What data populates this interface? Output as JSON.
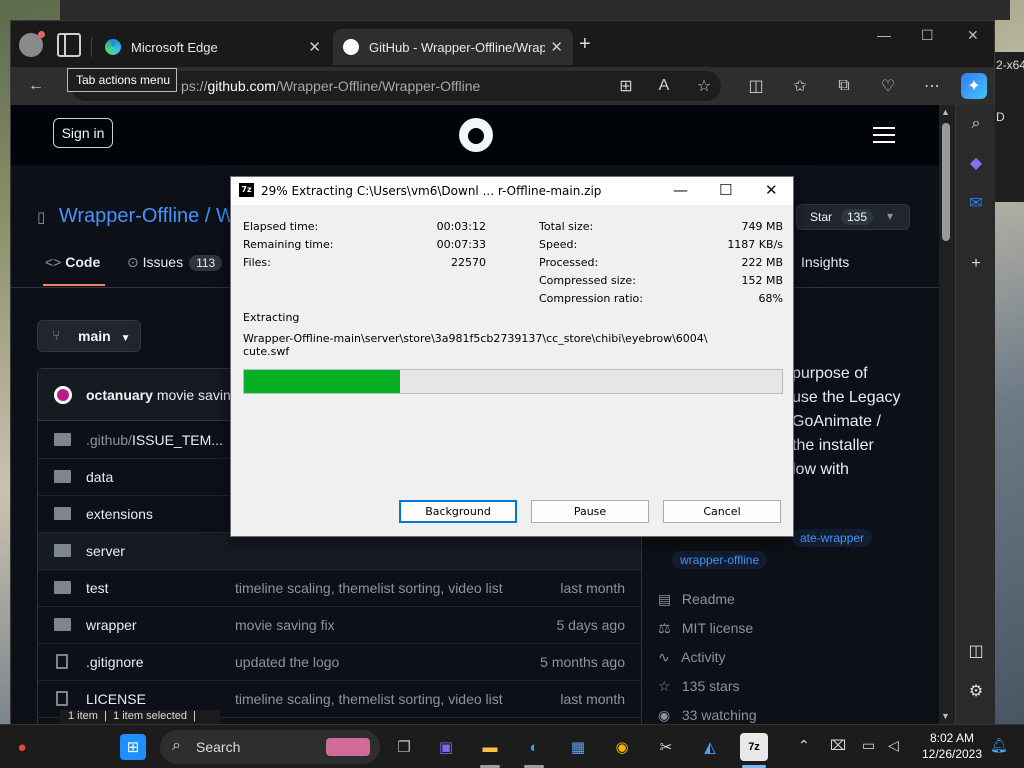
{
  "background": {
    "left_window_text": "2-x64",
    "left_window_text2": "D"
  },
  "browser": {
    "tabs": [
      {
        "label": "Microsoft Edge",
        "active": false
      },
      {
        "label": "GitHub - Wrapper-Offline/Wrapp",
        "active": true
      }
    ],
    "tooltip": "Tab actions menu",
    "url_prefix": "ps://",
    "url_host": "github.com",
    "url_path": "/Wrapper-Offline/Wrapper-Offline"
  },
  "github": {
    "sign_in": "Sign in",
    "repo_owner": "Wrapper-Offline",
    "repo_sep": "/",
    "repo_name_partial": "W",
    "star_label": "Star",
    "star_count": "135",
    "nav": {
      "code": "Code",
      "issues": "Issues",
      "issues_count": "113",
      "insights": "Insights"
    },
    "branch": "main",
    "commit": {
      "author": "octanuary",
      "message": "movie saving"
    },
    "files": [
      {
        "name_muted": ".github/",
        "name": "ISSUE_TEM...",
        "type": "folder",
        "message": "",
        "date": ""
      },
      {
        "name_muted": "",
        "name": "data",
        "type": "folder",
        "message": "",
        "date": ""
      },
      {
        "name_muted": "",
        "name": "extensions",
        "type": "folder",
        "message": "",
        "date": ""
      },
      {
        "name_muted": "",
        "name": "server",
        "type": "folder",
        "message": "",
        "date": ""
      },
      {
        "name_muted": "",
        "name": "test",
        "type": "folder",
        "message": "timeline scaling, themelist sorting, video list",
        "date": "last month"
      },
      {
        "name_muted": "",
        "name": "wrapper",
        "type": "folder",
        "message": "movie saving fix",
        "date": "5 days ago"
      },
      {
        "name_muted": "",
        "name": ".gitignore",
        "type": "file",
        "message": "updated the logo",
        "date": "5 months ago"
      },
      {
        "name_muted": "",
        "name": "LICENSE",
        "type": "file",
        "message": "timeline scaling, themelist sorting, video list",
        "date": "last month"
      }
    ],
    "about_lines": [
      "purpose of",
      "use the Legacy",
      "GoAnimate /",
      " the installer",
      "low with"
    ],
    "topics": [
      "ate-wrapper",
      "wrapper-offline"
    ],
    "side_items": [
      {
        "icon": "book-icon",
        "label": "Readme"
      },
      {
        "icon": "scale-icon",
        "label": "MIT license"
      },
      {
        "icon": "pulse-icon",
        "label": "Activity"
      },
      {
        "icon": "star-icon",
        "label": "135 stars"
      },
      {
        "icon": "eye-icon",
        "label": "33 watching"
      }
    ]
  },
  "dialog": {
    "title": "29% Extracting C:\\Users\\vm6\\Downl ... r-Offline-main.zip",
    "left_stats": [
      {
        "label": "Elapsed time:",
        "value": "00:03:12"
      },
      {
        "label": "Remaining time:",
        "value": "00:07:33"
      },
      {
        "label": "Files:",
        "value": "22570"
      }
    ],
    "right_stats": [
      {
        "label": "Total size:",
        "value": "749 MB"
      },
      {
        "label": "Speed:",
        "value": "1187 KB/s"
      },
      {
        "label": "Processed:",
        "value": "222 MB"
      },
      {
        "label": "Compressed size:",
        "value": "152 MB"
      },
      {
        "label": "Compression ratio:",
        "value": "68%"
      }
    ],
    "action": "Extracting",
    "path_line1": "Wrapper-Offline-main\\server\\store\\3a981f5cb2739137\\cc_store\\chibi\\eyebrow\\6004\\",
    "path_line2": "cute.swf",
    "progress_fraction": 0.29,
    "buttons": {
      "background": "Background",
      "pause": "Pause",
      "cancel": "Cancel"
    }
  },
  "statusbar": {
    "items": "1 item",
    "selected": "1 item selected"
  },
  "taskbar": {
    "search_placeholder": "Search",
    "time": "8:02 AM",
    "date": "12/26/2023"
  },
  "colors": {
    "progress_fill": "#06b025",
    "gh_link": "#4493f8",
    "gh_bg": "#0d1117"
  }
}
